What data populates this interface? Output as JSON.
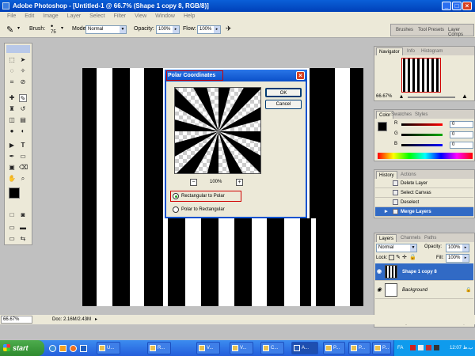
{
  "window": {
    "title": "Adobe Photoshop - [Untitled-1 @ 66.7% (Shape 1 copy 8, RGB/8)]"
  },
  "menu": [
    "File",
    "Edit",
    "Image",
    "Layer",
    "Select",
    "Filter",
    "View",
    "Window",
    "Help"
  ],
  "options": {
    "brush_label": "Brush:",
    "brush_size": "75",
    "mode_label": "Mode:",
    "mode_value": "Normal",
    "opacity_label": "Opacity:",
    "opacity_value": "100%",
    "flow_label": "Flow:",
    "flow_value": "100%",
    "well_tabs": [
      "Brushes",
      "Tool Presets",
      "Layer Comps"
    ]
  },
  "dialog": {
    "title": "Polar Coordinates",
    "ok_label": "OK",
    "cancel_label": "Cancel",
    "zoom_value": "100%",
    "zoom_out": "−",
    "zoom_in": "+",
    "option_rect_to_polar": "Rectangular to Polar",
    "option_polar_to_rect": "Polar to Rectangular",
    "selected_option": "Rectangular to Polar"
  },
  "navigator": {
    "tabs": [
      "Navigator",
      "Info",
      "Histogram"
    ],
    "zoom": "66.67%"
  },
  "color_panel": {
    "tabs": [
      "Color",
      "Swatches",
      "Styles"
    ],
    "channels": [
      {
        "label": "R",
        "value": "0",
        "color": "#e02020"
      },
      {
        "label": "G",
        "value": "0",
        "color": "#20a020"
      },
      {
        "label": "B",
        "value": "0",
        "color": "#2040e0"
      }
    ]
  },
  "history": {
    "tabs": [
      "History",
      "Actions"
    ],
    "items": [
      "Delete Layer",
      "Select Canvas",
      "Deselect",
      "Merge Layers"
    ],
    "active_item": "Merge Layers"
  },
  "layers": {
    "tabs": [
      "Layers",
      "Channels",
      "Paths"
    ],
    "blend_mode": "Normal",
    "opacity_label": "Opacity:",
    "opacity_value": "100%",
    "lock_label": "Lock:",
    "fill_label": "Fill:",
    "fill_value": "100%",
    "items": [
      {
        "name": "Shape 1 copy 8",
        "active": true
      },
      {
        "name": "Background",
        "active": false
      }
    ]
  },
  "status": {
    "zoom": "66.67%",
    "doc": "Doc: 2.16M/2.43M"
  },
  "taskbar": {
    "start_label": "start",
    "buttons": [
      "U...",
      "R...",
      "V...",
      "V...",
      "C...",
      "A...",
      "P...",
      "P...",
      "P..."
    ],
    "tray_lang": "FA",
    "clock": "12:07 ب.ظ"
  },
  "colors": {
    "accent": "#0a52d0",
    "history_highlight": "#316ac5",
    "dialog_outline": "#d00000"
  }
}
